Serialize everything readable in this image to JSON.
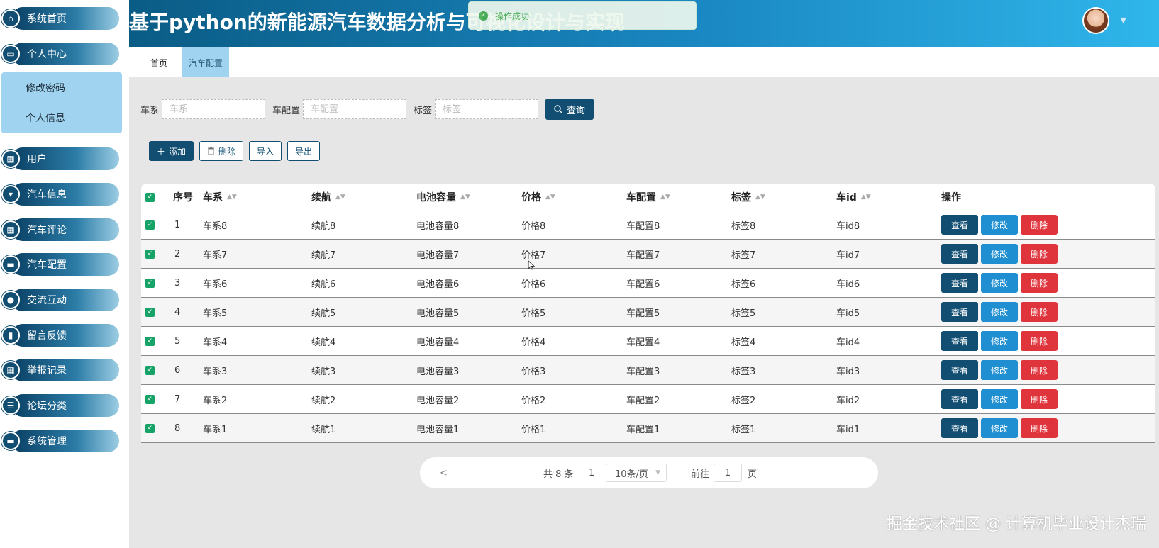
{
  "app": {
    "title": "基于python的新能源汽车数据分析与可视化设计与实现"
  },
  "toast": {
    "text": "操作成功"
  },
  "sidebar": {
    "items": [
      {
        "label": "系统首页",
        "icon": "home-icon",
        "glyph": "⌂"
      },
      {
        "label": "个人中心",
        "icon": "card-icon",
        "glyph": "▭"
      },
      {
        "label": "用户",
        "icon": "grid-icon",
        "glyph": "▦"
      },
      {
        "label": "汽车信息",
        "icon": "badge-icon",
        "glyph": "▾"
      },
      {
        "label": "汽车评论",
        "icon": "grid-icon",
        "glyph": "▦"
      },
      {
        "label": "汽车配置",
        "icon": "monitor-icon",
        "glyph": "▬"
      },
      {
        "label": "交流互动",
        "icon": "bulb-icon",
        "glyph": "●"
      },
      {
        "label": "留言反馈",
        "icon": "bar-chart-icon",
        "glyph": "▮"
      },
      {
        "label": "举报记录",
        "icon": "grid-icon",
        "glyph": "▦"
      },
      {
        "label": "论坛分类",
        "icon": "list-icon",
        "glyph": "☰"
      },
      {
        "label": "系统管理",
        "icon": "monitor-icon",
        "glyph": "▬"
      }
    ],
    "submenu": [
      {
        "label": "修改密码"
      },
      {
        "label": "个人信息"
      }
    ]
  },
  "tabs": [
    {
      "label": "首页"
    },
    {
      "label": "汽车配置"
    }
  ],
  "filters": {
    "series_label": "车系",
    "series_placeholder": "车系",
    "config_label": "车配置",
    "config_placeholder": "车配置",
    "tag_label": "标签",
    "tag_placeholder": "标签",
    "query_label": "查询"
  },
  "actions": {
    "add": "添加",
    "delete": "删除",
    "import": "导入",
    "export": "导出"
  },
  "table": {
    "headers": [
      "序号",
      "车系",
      "续航",
      "电池容量",
      "价格",
      "车配置",
      "标签",
      "车id",
      "操作"
    ],
    "rows": [
      {
        "no": "1",
        "series": "车系8",
        "range": "续航8",
        "battery": "电池容量8",
        "price": "价格8",
        "config": "车配置8",
        "tag": "标签8",
        "carid": "车id8"
      },
      {
        "no": "2",
        "series": "车系7",
        "range": "续航7",
        "battery": "电池容量7",
        "price": "价格7",
        "config": "车配置7",
        "tag": "标签7",
        "carid": "车id7"
      },
      {
        "no": "3",
        "series": "车系6",
        "range": "续航6",
        "battery": "电池容量6",
        "price": "价格6",
        "config": "车配置6",
        "tag": "标签6",
        "carid": "车id6"
      },
      {
        "no": "4",
        "series": "车系5",
        "range": "续航5",
        "battery": "电池容量5",
        "price": "价格5",
        "config": "车配置5",
        "tag": "标签5",
        "carid": "车id5"
      },
      {
        "no": "5",
        "series": "车系4",
        "range": "续航4",
        "battery": "电池容量4",
        "price": "价格4",
        "config": "车配置4",
        "tag": "标签4",
        "carid": "车id4"
      },
      {
        "no": "6",
        "series": "车系3",
        "range": "续航3",
        "battery": "电池容量3",
        "price": "价格3",
        "config": "车配置3",
        "tag": "标签3",
        "carid": "车id3"
      },
      {
        "no": "7",
        "series": "车系2",
        "range": "续航2",
        "battery": "电池容量2",
        "price": "价格2",
        "config": "车配置2",
        "tag": "标签2",
        "carid": "车id2"
      },
      {
        "no": "8",
        "series": "车系1",
        "range": "续航1",
        "battery": "电池容量1",
        "price": "价格1",
        "config": "车配置1",
        "tag": "标签1",
        "carid": "车id1"
      }
    ],
    "row_actions": {
      "view": "查看",
      "edit": "修改",
      "delete": "删除"
    }
  },
  "pagination": {
    "prev": "<",
    "total": "共 8 条",
    "current": "1",
    "page_size": "10条/页",
    "goto_label": "前往",
    "goto_value": "1",
    "page_suffix": "页"
  },
  "watermark": "掘金技术社区 @ 计算机毕业设计杰瑞",
  "colors": {
    "primary": "#114e72",
    "edit": "#1f8fd1",
    "danger": "#e0343d",
    "success": "#4caf50",
    "tab_active": "#9fd3ef"
  }
}
